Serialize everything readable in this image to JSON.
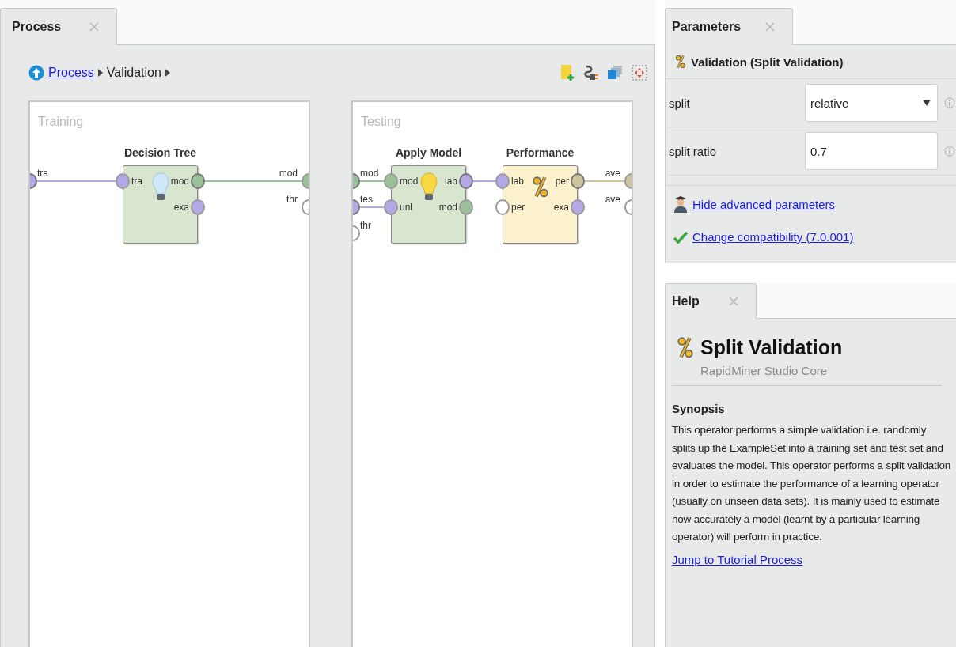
{
  "process_panel": {
    "tab": {
      "label": "Process",
      "selected": true
    },
    "breadcrumb": [
      {
        "label": "Process",
        "kind": "link"
      },
      {
        "label": "Validation",
        "kind": "current"
      }
    ],
    "subprocesses": [
      {
        "title": "Training",
        "inputs": [
          {
            "label": "tra",
            "color": "#b3a9e6",
            "connected": true
          }
        ],
        "outputs": [
          {
            "label": "mod",
            "color": "#9cc09a"
          },
          {
            "label": "thr",
            "color": "#ffffff"
          }
        ],
        "operators": [
          {
            "name": "Decision Tree",
            "kind": "learner",
            "inputs": [
              {
                "label": "tra",
                "color": "#b3a9e6"
              }
            ],
            "outputs": [
              {
                "label": "mod",
                "color": "#9cc09a",
                "connected": true
              },
              {
                "label": "exa",
                "color": "#b3a9e6",
                "connected": false
              }
            ]
          }
        ]
      },
      {
        "title": "Testing",
        "inputs": [
          {
            "label": "mod",
            "color": "#9cc09a",
            "connected": true
          },
          {
            "label": "tes",
            "color": "#b3a9e6",
            "connected": true
          },
          {
            "label": "thr",
            "color": "#ffffff",
            "connected": false
          }
        ],
        "outputs": [
          {
            "label": "ave",
            "color": "#cdc49e"
          },
          {
            "label": "ave",
            "color": "#ffffff"
          }
        ],
        "operators": [
          {
            "name": "Apply Model",
            "kind": "applier",
            "inputs": [
              {
                "label": "mod",
                "color": "#9cc09a"
              },
              {
                "label": "unl",
                "color": "#b3a9e6"
              }
            ],
            "outputs": [
              {
                "label": "lab",
                "color": "#b3a9e6",
                "connected": true
              },
              {
                "label": "mod",
                "color": "#9cc09a",
                "connected": false
              }
            ]
          },
          {
            "name": "Performance",
            "kind": "evaluator",
            "inputs": [
              {
                "label": "lab",
                "color": "#b3a9e6"
              },
              {
                "label": "per",
                "color": "#ffffff"
              }
            ],
            "outputs": [
              {
                "label": "per",
                "color": "#cdc49e",
                "connected": true
              },
              {
                "label": "exa",
                "color": "#b3a9e6",
                "connected": false
              }
            ]
          }
        ]
      }
    ]
  },
  "parameters_panel": {
    "tab": {
      "label": "Parameters",
      "selected": true
    },
    "operator": "Validation (Split Validation)",
    "params": [
      {
        "name": "split",
        "kind": "dropdown",
        "value": "relative"
      },
      {
        "name": "split ratio",
        "kind": "text",
        "value": "0.7"
      }
    ],
    "links": [
      {
        "label": "Hide advanced parameters",
        "kind": "advanced"
      },
      {
        "label": "Change compatibility (7.0.001)",
        "kind": "compatibility"
      }
    ]
  },
  "help_panel": {
    "tab": {
      "label": "Help",
      "selected": true
    },
    "title": "Split Validation",
    "subtitle": "RapidMiner Studio Core",
    "section": "Synopsis",
    "text": "This operator performs a simple validation i.e. randomly splits up the ExampleSet into a training set and test set and evaluates the model. This operator performs a split validation in order to estimate the performance of a learning operator (usually on unseen data sets). It is mainly used to estimate how accurately a model (learnt by a particular learning operator) will perform in practice.",
    "link": "Jump to Tutorial Process"
  }
}
